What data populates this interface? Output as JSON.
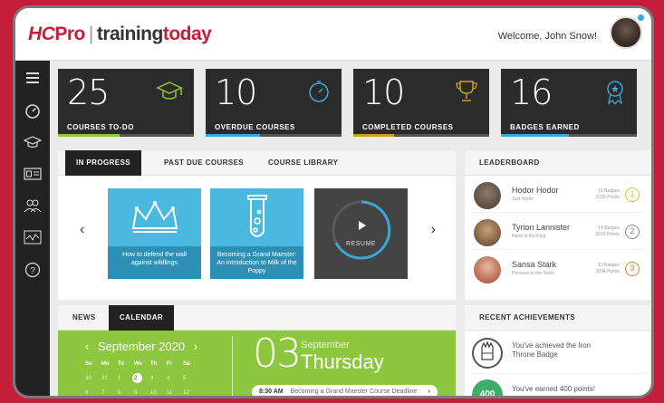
{
  "brand": {
    "hc": "HC",
    "pro": "Pro",
    "sep": "|",
    "training": "training",
    "today": "today"
  },
  "header": {
    "welcome": "Welcome, John Snow!"
  },
  "stats": [
    {
      "value": "25",
      "label": "COURSES TO-DO",
      "icon": "graduation-cap-icon",
      "color": "#8dc63f",
      "progress": 0.45
    },
    {
      "value": "10",
      "label": "OVERDUE COURSES",
      "icon": "stopwatch-icon",
      "color": "#3aa7d6",
      "progress": 0.4
    },
    {
      "value": "10",
      "label": "COMPLETED COURSES",
      "icon": "trophy-icon",
      "color": "#c9a227",
      "progress": 0.3
    },
    {
      "value": "16",
      "label": "BADGES EARNED",
      "icon": "badge-ribbon-icon",
      "color": "#3aa7d6",
      "progress": 0.5
    }
  ],
  "courses": {
    "tabs": [
      "IN PROGRESS",
      "PAST DUE COURSES",
      "COURSE LIBRARY"
    ],
    "cards": [
      {
        "title": "How to defend the wall against wildlings",
        "icon": "crown-icon"
      },
      {
        "title": "Becoming a Grand Maester: An introduction to Milk of the Poppy",
        "icon": "test-tube-icon"
      },
      {
        "title": "RESUME",
        "icon": "play-icon"
      }
    ],
    "prev": "‹",
    "next": "›"
  },
  "leaderboard": {
    "title": "LEADERBOARD",
    "rows": [
      {
        "name": "Hodor Hodor",
        "sub": "Just Hodor",
        "stat1": "16 Badges",
        "stat2": "3239 Points",
        "rank": "1",
        "medal_color": "#e0b93a"
      },
      {
        "name": "Tyrion Lannister",
        "sub": "Hand of the King",
        "stat1": "14 Badges",
        "stat2": "3019 Points",
        "rank": "2",
        "medal_color": "#8a8a8a"
      },
      {
        "name": "Sansa Stark",
        "sub": "Princess to the North",
        "stat1": "12 Badges",
        "stat2": "3034 Points",
        "rank": "3",
        "medal_color": "#c88a2a"
      }
    ]
  },
  "news": {
    "tabs": [
      "NEWS",
      "CALENDAR"
    ],
    "calendar": {
      "month": "September 2020",
      "weekdays": [
        "Su",
        "Mo",
        "Tu",
        "We",
        "Th",
        "Fr",
        "Sa"
      ],
      "days": [
        "30",
        "31",
        "1",
        "2",
        "3",
        "4",
        "5"
      ],
      "days2": [
        "6",
        "7",
        "8",
        "9",
        "10",
        "11",
        "12"
      ],
      "day_num": "03",
      "day_month": "September",
      "day_name": "Thursday",
      "event_time": "8:30 AM",
      "event_text": "Becoming a Grand Maester Course Deadline"
    }
  },
  "achievements": {
    "title": "RECENT ACHIEVEMENTS",
    "rows": [
      {
        "text": "You've achieved the Iron Throne Badge",
        "badge": "throne-badge-icon"
      },
      {
        "text": "You've earned 400 points!",
        "badge_value": "400"
      }
    ]
  },
  "sidebar": {
    "items": [
      "menu-icon",
      "dashboard-icon",
      "graduation-cap-icon",
      "id-card-icon",
      "users-icon",
      "activity-icon",
      "help-icon"
    ]
  }
}
